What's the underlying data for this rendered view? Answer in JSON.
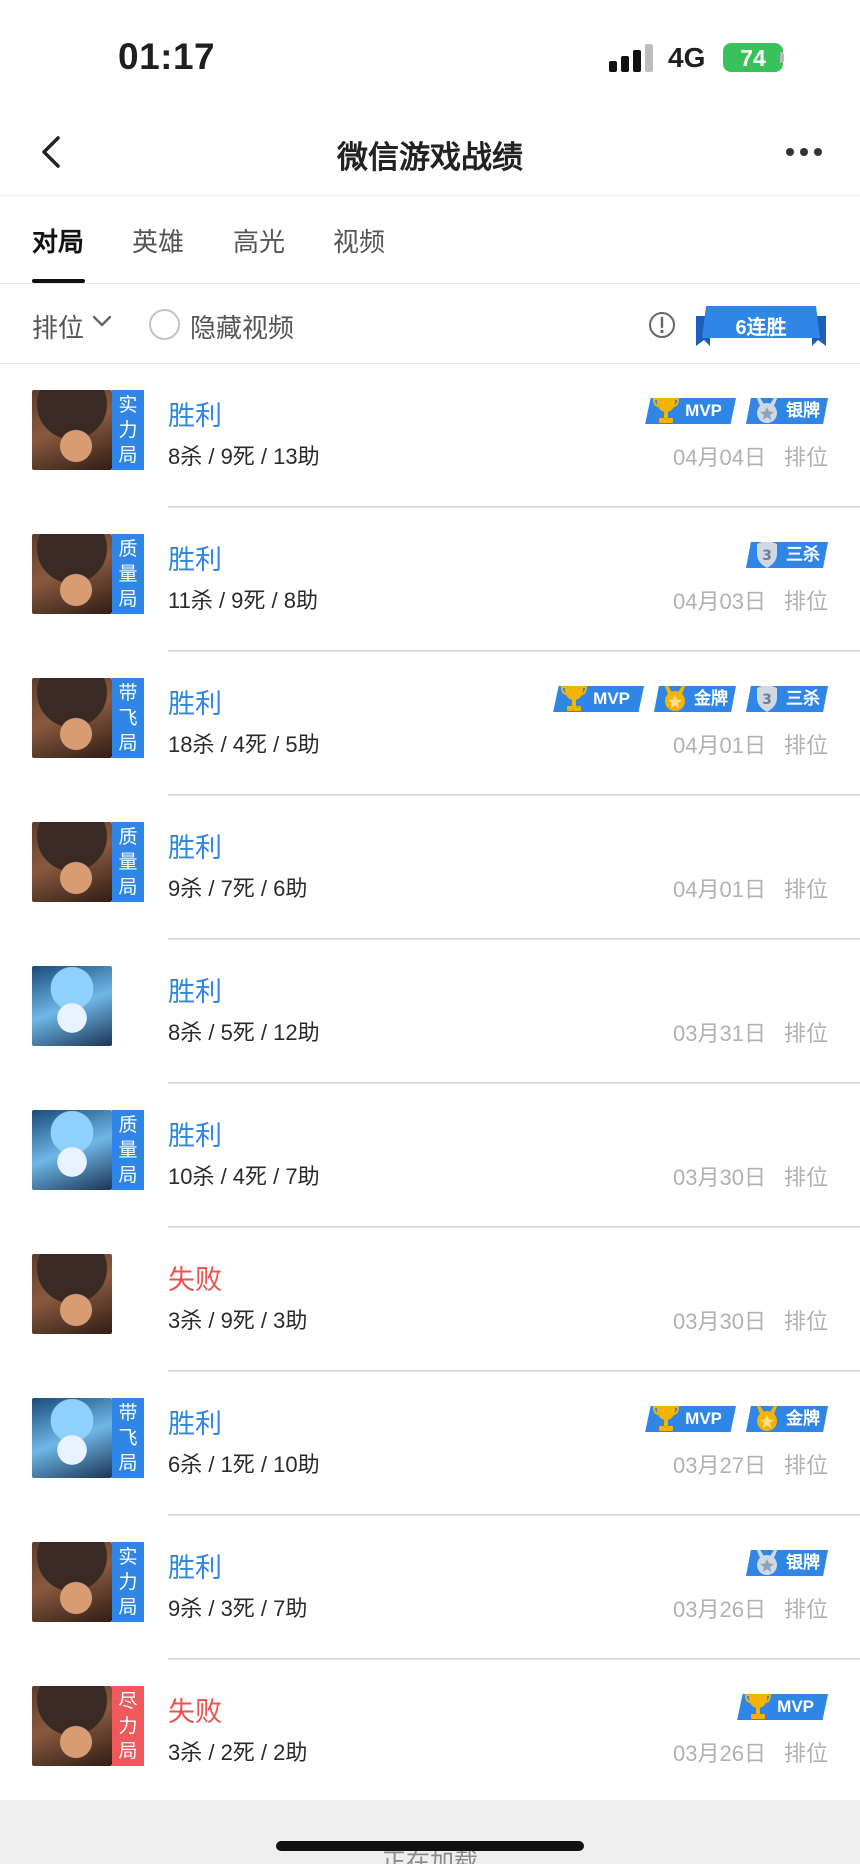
{
  "status_bar": {
    "time": "01:17",
    "network": "4G",
    "battery": "74"
  },
  "header": {
    "title": "微信游戏战绩"
  },
  "tabs": [
    {
      "label": "对局",
      "active": true
    },
    {
      "label": "英雄",
      "active": false
    },
    {
      "label": "高光",
      "active": false
    },
    {
      "label": "视频",
      "active": false
    }
  ],
  "filter": {
    "mode": "排位",
    "hide_video": "隐藏视频",
    "streak": "6连胜"
  },
  "matches": [
    {
      "tag": "实力局",
      "result": "胜利",
      "kda": "8杀 / 9死 / 13助",
      "date": "04月04日",
      "mode": "排位",
      "badges": [
        "MVP",
        "银牌"
      ]
    },
    {
      "tag": "质量局",
      "result": "胜利",
      "kda": "11杀 / 9死 / 8助",
      "date": "04月03日",
      "mode": "排位",
      "badges": [
        "三杀"
      ]
    },
    {
      "tag": "带飞局",
      "result": "胜利",
      "kda": "18杀 / 4死 / 5助",
      "date": "04月01日",
      "mode": "排位",
      "badges": [
        "MVP",
        "金牌",
        "三杀"
      ]
    },
    {
      "tag": "质量局",
      "result": "胜利",
      "kda": "9杀 / 7死 / 6助",
      "date": "04月01日",
      "mode": "排位",
      "badges": []
    },
    {
      "tag": "",
      "result": "胜利",
      "kda": "8杀 / 5死 / 12助",
      "date": "03月31日",
      "mode": "排位",
      "badges": []
    },
    {
      "tag": "质量局",
      "result": "胜利",
      "kda": "10杀 / 4死 / 7助",
      "date": "03月30日",
      "mode": "排位",
      "badges": []
    },
    {
      "tag": "",
      "result": "失败",
      "kda": "3杀 / 9死 / 3助",
      "date": "03月30日",
      "mode": "排位",
      "badges": []
    },
    {
      "tag": "带飞局",
      "result": "胜利",
      "kda": "6杀 / 1死 / 10助",
      "date": "03月27日",
      "mode": "排位",
      "badges": [
        "MVP",
        "金牌"
      ]
    },
    {
      "tag": "实力局",
      "result": "胜利",
      "kda": "9杀 / 3死 / 7助",
      "date": "03月26日",
      "mode": "排位",
      "badges": [
        "银牌"
      ]
    },
    {
      "tag": "尽力局",
      "result": "失败",
      "kda": "3杀 / 2死 / 2助",
      "date": "03月26日",
      "mode": "排位",
      "badges": [
        "MVP"
      ]
    }
  ],
  "footer": {
    "loading": "正在加载"
  },
  "colors": {
    "accent": "#2f86e6",
    "lose": "#ef4f4f",
    "battery": "#39c25a"
  }
}
